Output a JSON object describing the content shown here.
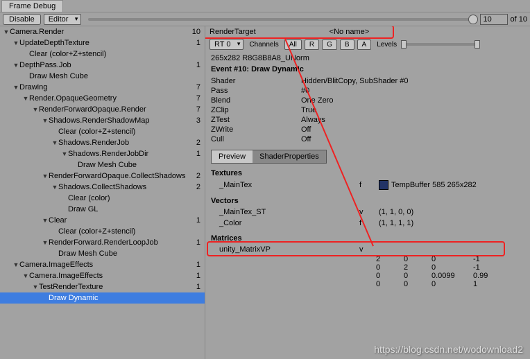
{
  "window": {
    "title": "Frame Debug"
  },
  "toolbar": {
    "disable": "Disable",
    "editor": "Editor",
    "current": "10",
    "total": "of 10"
  },
  "tree": [
    {
      "indent": 0,
      "tri": "▼",
      "label": "Camera.Render",
      "num": "10"
    },
    {
      "indent": 1,
      "tri": "▼",
      "label": "UpdateDepthTexture",
      "num": "1"
    },
    {
      "indent": 2,
      "tri": "",
      "label": "Clear (color+Z+stencil)",
      "num": ""
    },
    {
      "indent": 1,
      "tri": "▼",
      "label": "DepthPass.Job",
      "num": "1"
    },
    {
      "indent": 2,
      "tri": "",
      "label": "Draw Mesh Cube",
      "num": ""
    },
    {
      "indent": 1,
      "tri": "▼",
      "label": "Drawing",
      "num": "7"
    },
    {
      "indent": 2,
      "tri": "▼",
      "label": "Render.OpaqueGeometry",
      "num": "7"
    },
    {
      "indent": 3,
      "tri": "▼",
      "label": "RenderForwardOpaque.Render",
      "num": "7"
    },
    {
      "indent": 4,
      "tri": "▼",
      "label": "Shadows.RenderShadowMap",
      "num": "3"
    },
    {
      "indent": 5,
      "tri": "",
      "label": "Clear (color+Z+stencil)",
      "num": ""
    },
    {
      "indent": 5,
      "tri": "▼",
      "label": "Shadows.RenderJob",
      "num": "2"
    },
    {
      "indent": 6,
      "tri": "▼",
      "label": "Shadows.RenderJobDir",
      "num": "1"
    },
    {
      "indent": 7,
      "tri": "",
      "label": "Draw Mesh Cube",
      "num": ""
    },
    {
      "indent": 4,
      "tri": "▼",
      "label": "RenderForwardOpaque.CollectShadows",
      "num": "2"
    },
    {
      "indent": 5,
      "tri": "▼",
      "label": "Shadows.CollectShadows",
      "num": "2"
    },
    {
      "indent": 6,
      "tri": "",
      "label": "Clear (color)",
      "num": ""
    },
    {
      "indent": 6,
      "tri": "",
      "label": "Draw GL",
      "num": ""
    },
    {
      "indent": 4,
      "tri": "▼",
      "label": "Clear",
      "num": "1"
    },
    {
      "indent": 5,
      "tri": "",
      "label": "Clear (color+Z+stencil)",
      "num": ""
    },
    {
      "indent": 4,
      "tri": "▼",
      "label": "RenderForward.RenderLoopJob",
      "num": "1"
    },
    {
      "indent": 5,
      "tri": "",
      "label": "Draw Mesh Cube",
      "num": ""
    },
    {
      "indent": 1,
      "tri": "▼",
      "label": "Camera.ImageEffects",
      "num": "1"
    },
    {
      "indent": 2,
      "tri": "▼",
      "label": "Camera.ImageEffects",
      "num": "1"
    },
    {
      "indent": 3,
      "tri": "▼",
      "label": "TestRenderTexture",
      "num": "1"
    },
    {
      "indent": 4,
      "tri": "",
      "label": "Draw Dynamic",
      "num": "",
      "selected": true
    }
  ],
  "rt": {
    "label": "RenderTarget",
    "value": "<No name>",
    "rt0": "RT 0",
    "channels": "Channels",
    "all": "All",
    "r": "R",
    "g": "G",
    "b": "B",
    "a": "A",
    "levels": "Levels",
    "fmt": "265x282 R8G8B8A8_UNorm"
  },
  "event": {
    "title": "Event #10: Draw Dynamic",
    "rows": [
      {
        "k": "Shader",
        "v": "Hidden/BlitCopy, SubShader #0"
      },
      {
        "k": "Pass",
        "v": "#0"
      },
      {
        "k": "Blend",
        "v": "One Zero"
      },
      {
        "k": "ZClip",
        "v": "True"
      },
      {
        "k": "ZTest",
        "v": "Always"
      },
      {
        "k": "ZWrite",
        "v": "Off"
      },
      {
        "k": "Cull",
        "v": "Off"
      }
    ]
  },
  "tabs": {
    "preview": "Preview",
    "shaderprops": "ShaderProperties"
  },
  "textures": {
    "header": "Textures",
    "row": {
      "name": "_MainTex",
      "type": "f",
      "value": "TempBuffer 585 265x282"
    }
  },
  "vectors": {
    "header": "Vectors",
    "rows": [
      {
        "name": "_MainTex_ST",
        "type": "v",
        "value": "(1, 1, 0, 0)"
      },
      {
        "name": "_Color",
        "type": "f",
        "value": "(1, 1, 1, 1)"
      }
    ]
  },
  "matrices": {
    "header": "Matrices",
    "name": "unity_MatrixVP",
    "type": "v",
    "m": [
      [
        "2",
        "0",
        "0",
        "-1"
      ],
      [
        "0",
        "2",
        "0",
        "-1"
      ],
      [
        "0",
        "0",
        "0.0099",
        "0.99"
      ],
      [
        "0",
        "0",
        "0",
        "1"
      ]
    ]
  },
  "watermark": "https://blog.csdn.net/wodownload2"
}
